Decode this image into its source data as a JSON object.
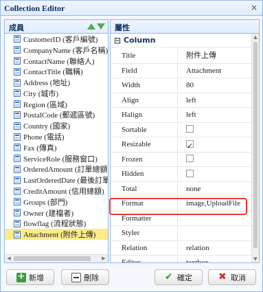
{
  "window": {
    "title": "Collection Editor",
    "close_glyph": "×"
  },
  "left_panel": {
    "header": "成員",
    "move_up_icon": "arrow-up-icon",
    "move_down_icon": "arrow-down-icon",
    "items": [
      {
        "label": "CustomerID (客戶編號)"
      },
      {
        "label": "CompanyName (客戶名稱)"
      },
      {
        "label": "ContactName (聯絡人)"
      },
      {
        "label": "ContactTitle (職稱)"
      },
      {
        "label": "Address (地址)"
      },
      {
        "label": "City (城市)"
      },
      {
        "label": "Region (區域)"
      },
      {
        "label": "PostalCode (郵遞區號)"
      },
      {
        "label": "Country (國家)"
      },
      {
        "label": "Phone (電話)"
      },
      {
        "label": "Fax (傳真)"
      },
      {
        "label": "ServiceRole (服務窗口)"
      },
      {
        "label": "OrderedAmount (訂單總額)"
      },
      {
        "label": "LastOrderedDate (最後訂單日"
      },
      {
        "label": "CreditAmount (信用總額)"
      },
      {
        "label": "Groups (部門)"
      },
      {
        "label": "Owner (建檔者)"
      },
      {
        "label": "flowflag (流程狀態)"
      },
      {
        "label": "Attachment (附件上傳)"
      }
    ],
    "selected_index": 18
  },
  "right_panel": {
    "header": "屬性",
    "group_label": "Column",
    "group_toggle": "⊟",
    "properties": [
      {
        "name": "Title",
        "value": "附件上傳"
      },
      {
        "name": "Field",
        "value": "Attachment"
      },
      {
        "name": "Width",
        "value": "80"
      },
      {
        "name": "Align",
        "value": "left"
      },
      {
        "name": "Halign",
        "value": "left"
      },
      {
        "name": "Sortable",
        "checkbox": false
      },
      {
        "name": "Resizable",
        "checkbox": true
      },
      {
        "name": "Frozen",
        "checkbox": false
      },
      {
        "name": "Hidden",
        "checkbox": false
      },
      {
        "name": "Total",
        "value": "none"
      },
      {
        "name": "Format",
        "value": "image,UploadFile"
      },
      {
        "name": "Formatter",
        "value": ""
      },
      {
        "name": "Styler",
        "value": ""
      },
      {
        "name": "Relation",
        "value": "relation"
      },
      {
        "name": "Editor",
        "value": "textbox"
      }
    ],
    "highlighted_property": "Format",
    "highlight_color": "#e53935"
  },
  "buttons": {
    "add": "新增",
    "delete": "刪除",
    "ok": "確定",
    "cancel": "取消"
  }
}
